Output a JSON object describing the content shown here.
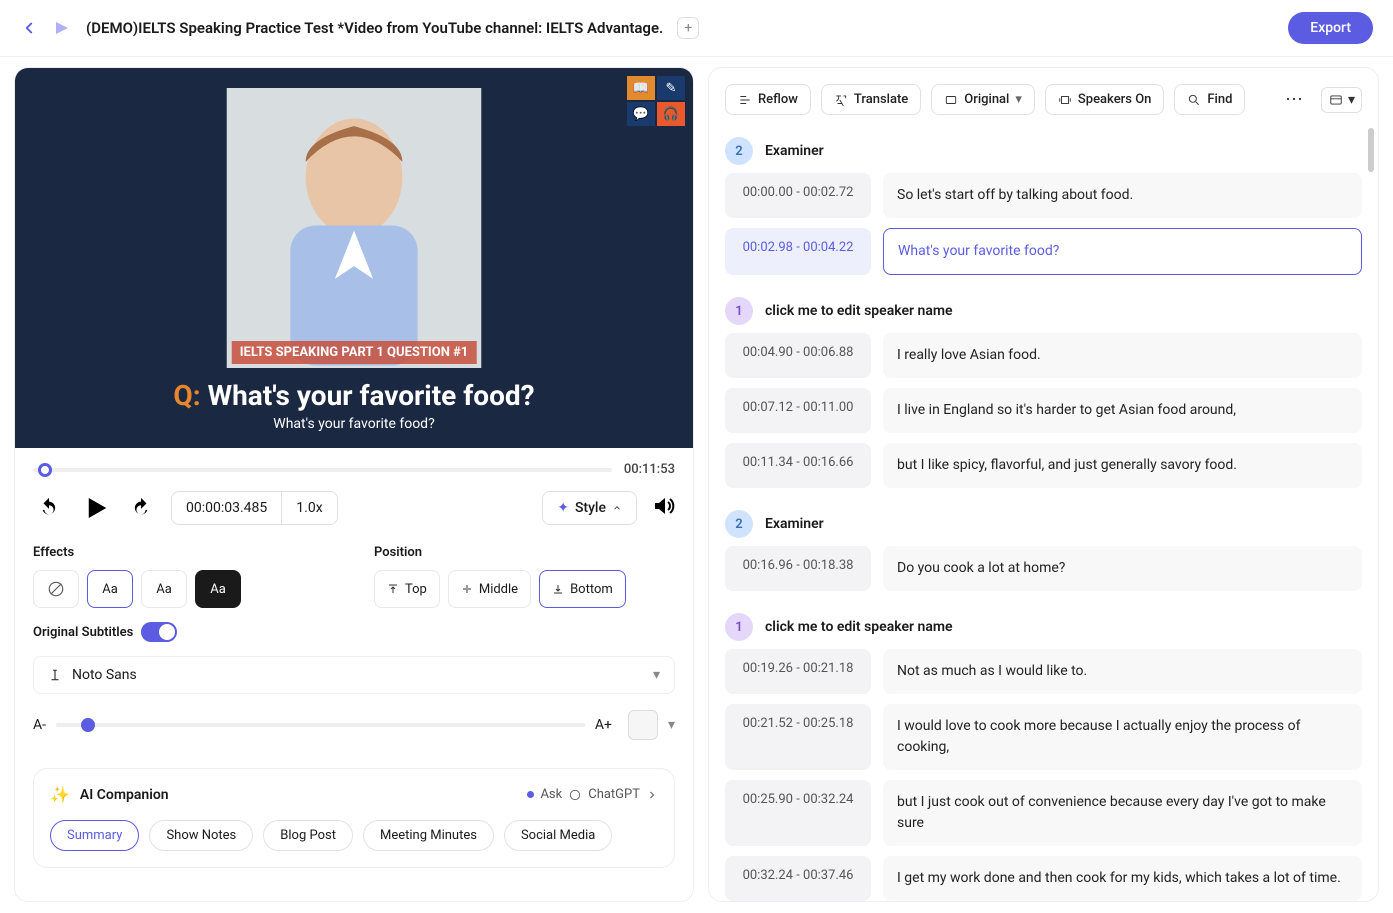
{
  "header": {
    "title": "(DEMO)IELTS Speaking Practice Test *Video from YouTube channel: IELTS Advantage.",
    "export": "Export"
  },
  "video": {
    "caption_pill": "IELTS SPEAKING PART 1 QUESTION #1",
    "question_prefix": "Q:",
    "question": "What's your favorite food?",
    "sub": "What's your favorite food?",
    "duration": "00:11:53",
    "timecode": "00:00:03.485",
    "speed": "1.0x"
  },
  "style_btn": "Style",
  "effects": {
    "title": "Effects",
    "opt1": "Aa",
    "opt2": "Aa",
    "opt3": "Aa"
  },
  "position": {
    "title": "Position",
    "top": "Top",
    "middle": "Middle",
    "bottom": "Bottom"
  },
  "orig_sub_label": "Original Subtitles",
  "font": {
    "name": "Noto Sans",
    "a_minus": "A-",
    "a_plus": "A+"
  },
  "ai": {
    "title": "AI Companion",
    "ask": "Ask",
    "chatgpt": "ChatGPT",
    "chips": [
      "Summary",
      "Show Notes",
      "Blog Post",
      "Meeting Minutes",
      "Social Media"
    ]
  },
  "toolbar": {
    "reflow": "Reflow",
    "translate": "Translate",
    "original": "Original",
    "speakers": "Speakers On",
    "find": "Find"
  },
  "transcript": [
    {
      "type": "speaker",
      "badge": "2",
      "badgeClass": "sb-blue",
      "name": "Examiner"
    },
    {
      "type": "line",
      "time": "00:00.00 - 00:02.72",
      "text": "So let's start off by talking about food."
    },
    {
      "type": "line",
      "active": true,
      "time": "00:02.98 - 00:04.22",
      "text": "What's your favorite food?"
    },
    {
      "type": "speaker",
      "badge": "1",
      "badgeClass": "sb-purple",
      "name": "click me to edit speaker name"
    },
    {
      "type": "line",
      "time": "00:04.90 - 00:06.88",
      "text": "I really love Asian food."
    },
    {
      "type": "line",
      "time": "00:07.12 - 00:11.00",
      "text": "I live in England so it's harder to get Asian food around,"
    },
    {
      "type": "line",
      "time": "00:11.34 - 00:16.66",
      "text": "but I like spicy, flavorful, and just generally savory food."
    },
    {
      "type": "speaker",
      "badge": "2",
      "badgeClass": "sb-blue",
      "name": "Examiner"
    },
    {
      "type": "line",
      "time": "00:16.96 - 00:18.38",
      "text": "Do you cook a lot at home?"
    },
    {
      "type": "speaker",
      "badge": "1",
      "badgeClass": "sb-purple",
      "name": "click me to edit speaker name"
    },
    {
      "type": "line",
      "time": "00:19.26 - 00:21.18",
      "text": "Not as much as I would like to."
    },
    {
      "type": "line",
      "time": "00:21.52 - 00:25.18",
      "text": "I would love to cook more because I actually enjoy the process of cooking,"
    },
    {
      "type": "line",
      "time": "00:25.90 - 00:32.24",
      "text": "but I just cook out of convenience because every day I've got to make sure"
    },
    {
      "type": "line",
      "time": "00:32.24 - 00:37.46",
      "text": "I get my work done and then cook for my kids, which takes a lot of time."
    }
  ]
}
